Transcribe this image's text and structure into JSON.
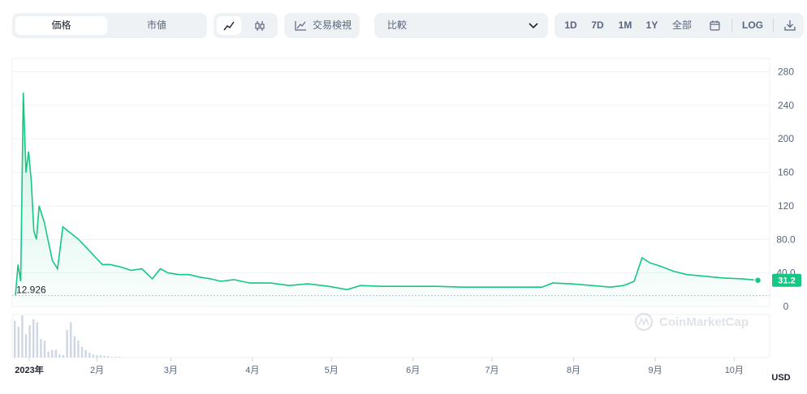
{
  "toolbar": {
    "tabs": [
      "価格",
      "市値"
    ],
    "active_tab": "価格",
    "trading_view_label": "交易検視",
    "compare_label": "比較",
    "ranges": [
      "1D",
      "7D",
      "1M",
      "1Y",
      "全部"
    ],
    "log_label": "LOG"
  },
  "watermark": "CoinMarketCap",
  "colors": {
    "line": "#16c784",
    "grid": "#eff2f5",
    "volume": "#cfd6e4",
    "text": "#58667e"
  },
  "current_price_label": "31.2",
  "min_label": "12.926",
  "currency_label": "USD",
  "chart_data": {
    "type": "line",
    "title": "",
    "xlabel": "",
    "ylabel": "",
    "ylim": [
      0,
      280
    ],
    "yticks": [
      0,
      40.0,
      80.0,
      120,
      160,
      200,
      240,
      280
    ],
    "ytick_labels": [
      "0",
      "40.0",
      "80.0",
      "120",
      "160",
      "200",
      "240",
      "280"
    ],
    "xticks": [
      "2023年",
      "2月",
      "3月",
      "4月",
      "5月",
      "6月",
      "7月",
      "8月",
      "9月",
      "10月"
    ],
    "series": [
      {
        "x": [
          "2023-01-01",
          "2023-01-02",
          "2023-01-03",
          "2023-01-04",
          "2023-01-05",
          "2023-01-06",
          "2023-01-07",
          "2023-01-08",
          "2023-01-09",
          "2023-01-10",
          "2023-01-11",
          "2023-01-12",
          "2023-01-13",
          "2023-01-14",
          "2023-01-15",
          "2023-01-17",
          "2023-01-19",
          "2023-01-21",
          "2023-01-23",
          "2023-01-25",
          "2023-01-28",
          "2023-01-31",
          "2023-02-03",
          "2023-02-06",
          "2023-02-10",
          "2023-02-14",
          "2023-02-18",
          "2023-02-22",
          "2023-02-25",
          "2023-02-28",
          "2023-03-04",
          "2023-03-08",
          "2023-03-12",
          "2023-03-16",
          "2023-03-20",
          "2023-03-25",
          "2023-03-31",
          "2023-04-08",
          "2023-04-15",
          "2023-04-22",
          "2023-04-30",
          "2023-05-07",
          "2023-05-12",
          "2023-05-20",
          "2023-05-31",
          "2023-06-10",
          "2023-06-20",
          "2023-06-30",
          "2023-07-10",
          "2023-07-20",
          "2023-07-24",
          "2023-07-31",
          "2023-08-08",
          "2023-08-15",
          "2023-08-20",
          "2023-08-24",
          "2023-08-27",
          "2023-08-30",
          "2023-09-03",
          "2023-09-08",
          "2023-09-13",
          "2023-09-20",
          "2023-09-27",
          "2023-10-04",
          "2023-10-10"
        ],
        "y": [
          12.926,
          50,
          30,
          255,
          160,
          185,
          150,
          90,
          80,
          120,
          110,
          100,
          85,
          70,
          55,
          45,
          95,
          90,
          85,
          80,
          70,
          60,
          50,
          50,
          47,
          43,
          45,
          33,
          45,
          40,
          38,
          38,
          35,
          33,
          30,
          32,
          28,
          28,
          25,
          27,
          24,
          20,
          25,
          24,
          24,
          24,
          23,
          23,
          23,
          23,
          28,
          27,
          25,
          23,
          25,
          30,
          58,
          52,
          48,
          42,
          38,
          36,
          34,
          33,
          31.2
        ]
      }
    ],
    "volume": [
      48,
      40,
      55,
      30,
      42,
      50,
      46,
      24,
      22,
      8,
      10,
      10,
      4,
      3,
      36,
      46,
      28,
      22,
      14,
      10,
      6,
      4,
      3,
      3,
      2,
      2,
      1,
      1,
      1
    ]
  }
}
